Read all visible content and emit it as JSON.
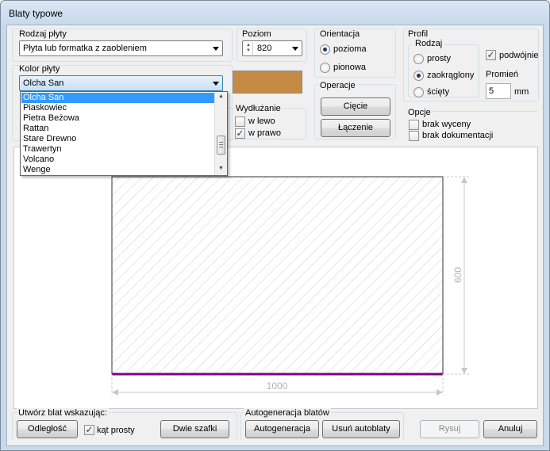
{
  "window": {
    "title": "Blaty typowe"
  },
  "plate_type": {
    "label": "Rodzaj płyty",
    "selected": "Płyta lub formatka z zaobleniem"
  },
  "level": {
    "label": "Poziom",
    "value": "820"
  },
  "orientation": {
    "label": "Orientacja",
    "horizontal": "pozioma",
    "vertical": "pionowa"
  },
  "operations": {
    "label": "Operacje",
    "cut": "Cięcie",
    "join": "Łączenie"
  },
  "profile": {
    "label": "Profil",
    "kind_label": "Rodzaj",
    "straight": "prosty",
    "rounded": "zaokrąglony",
    "chamfered": "ścięty",
    "double": "podwójnie",
    "radius_label": "Promień",
    "radius_value": "5",
    "radius_unit": "mm"
  },
  "color": {
    "label": "Kolor płyty",
    "selected": "Olcha San",
    "swatch": "#c58b45",
    "options": [
      "Olcha San",
      "Piaskowiec",
      "Pietra Beżowa",
      "Rattan",
      "Stare Drewno",
      "Trawertyn",
      "Volcano",
      "Wenge"
    ]
  },
  "extension": {
    "label": "Wydłużanie",
    "left": "w lewo",
    "right": "w prawo"
  },
  "options": {
    "label": "Opcje",
    "no_pricing": "brak wyceny",
    "no_docs": "brak dokumentacji"
  },
  "drawing": {
    "width": "1000",
    "height": "600",
    "edge_color": "#800080"
  },
  "create_by": {
    "label": "Utwórz blat wskazując:",
    "distance": "Odległość",
    "right_angle": "kąt prosty",
    "two_cabinets": "Dwie szafki"
  },
  "autogen": {
    "label": "Autogeneracja blatów",
    "autogen": "Autogeneracja",
    "remove": "Usuń autoblaty"
  },
  "footer": {
    "draw": "Rysuj",
    "cancel": "Anuluj"
  }
}
